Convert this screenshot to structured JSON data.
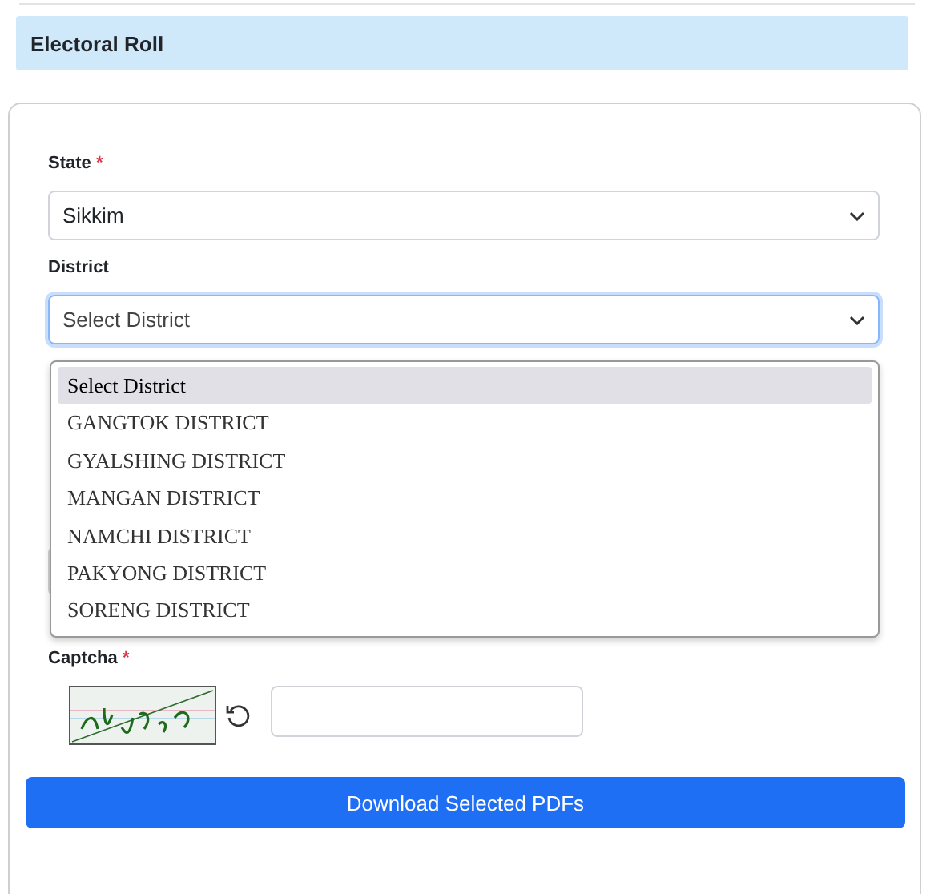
{
  "header": {
    "title": "Electoral Roll"
  },
  "form": {
    "state": {
      "label": "State",
      "required": "*",
      "value": "Sikkim"
    },
    "district": {
      "label": "District",
      "value": "Select District",
      "focused": true,
      "options": [
        {
          "label": "Select District",
          "selected": true
        },
        {
          "label": "GANGTOK DISTRICT",
          "selected": false
        },
        {
          "label": "GYALSHING DISTRICT",
          "selected": false
        },
        {
          "label": "MANGAN DISTRICT",
          "selected": false
        },
        {
          "label": "NAMCHI DISTRICT",
          "selected": false
        },
        {
          "label": "PAKYONG DISTRICT",
          "selected": false
        },
        {
          "label": "SORENG DISTRICT",
          "selected": false
        }
      ]
    },
    "captcha": {
      "label": "Captcha",
      "required": "*"
    },
    "submit": "Download Selected PDFs"
  }
}
